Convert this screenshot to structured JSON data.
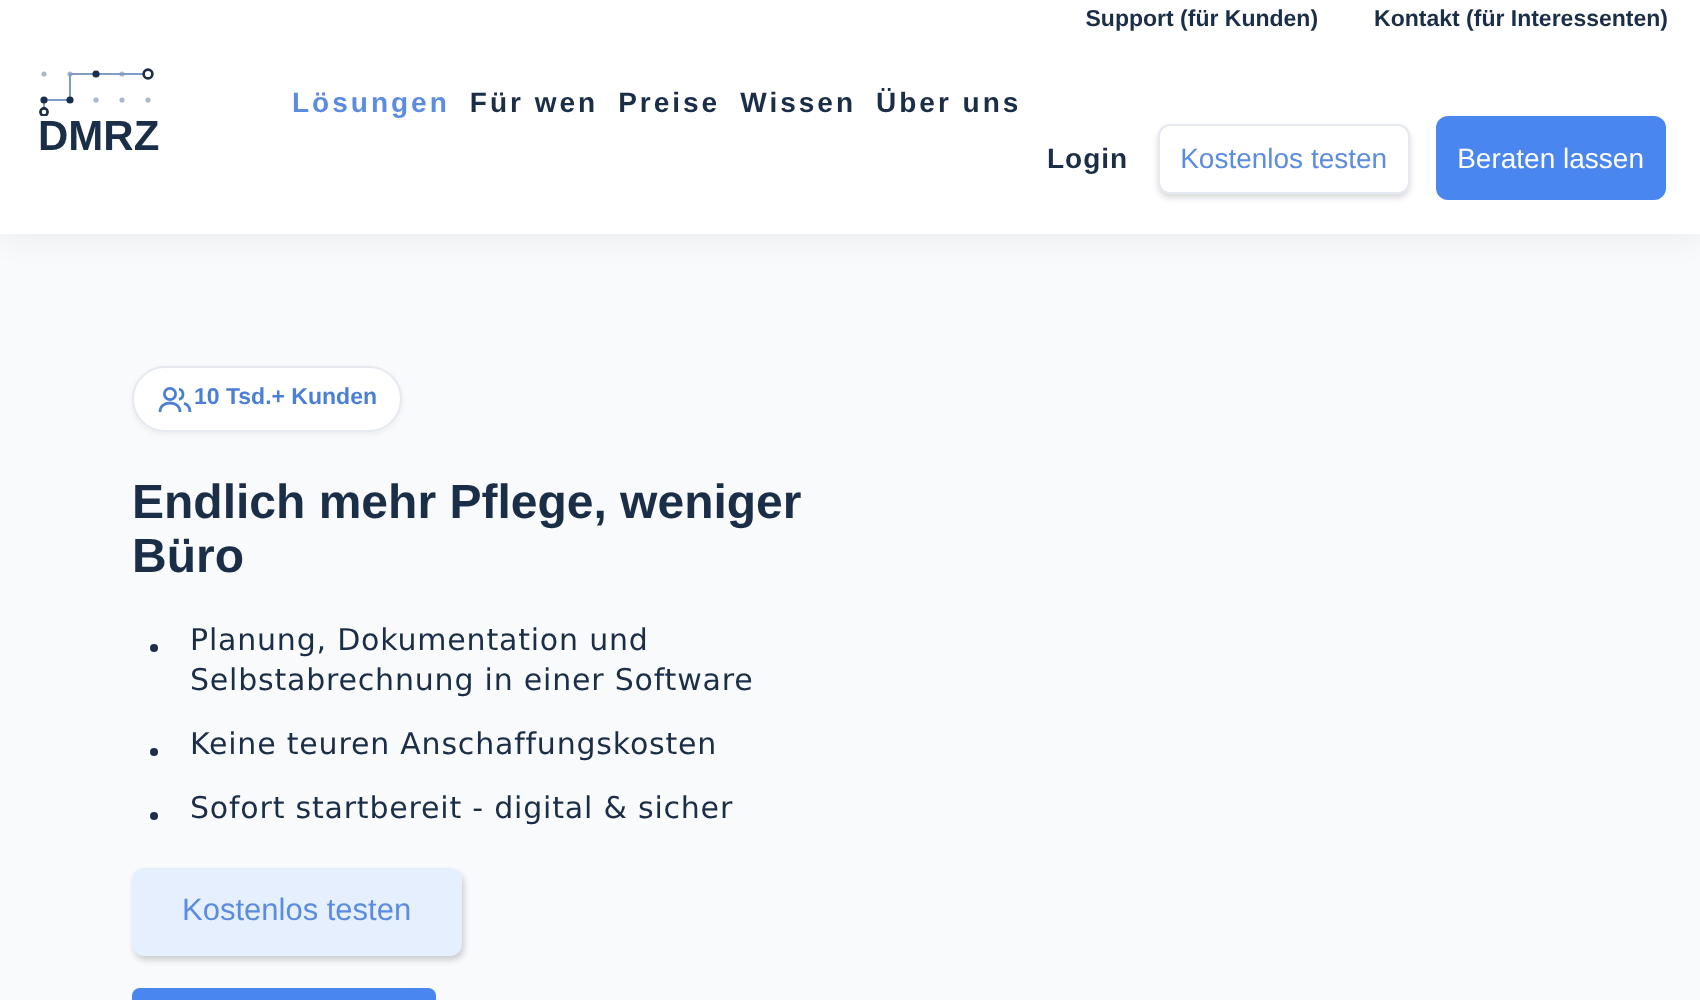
{
  "logo": {
    "text": "DMRZ"
  },
  "top_links": [
    "Support (für Kunden)",
    "Kontakt (für Interessenten)"
  ],
  "nav": [
    {
      "label": "Lösungen",
      "selected": true
    },
    {
      "label": "Für wen",
      "selected": false
    },
    {
      "label": "Preise",
      "selected": false
    },
    {
      "label": "Wissen",
      "selected": false
    },
    {
      "label": "Über uns",
      "selected": false
    }
  ],
  "header_actions": {
    "login": "Login",
    "trial": "Kostenlos testen",
    "consult": "Beraten lassen"
  },
  "hero": {
    "badge": "10 Tsd.+ Kunden",
    "title": "Endlich mehr Pflege, weniger Büro",
    "bullets": [
      "Planung, Dokumentation und Selbstabrechnung in einer Software",
      "Keine teuren Anschaffungskosten",
      "Sofort startbereit - digital & sicher"
    ],
    "cta": "Kostenlos testen"
  }
}
